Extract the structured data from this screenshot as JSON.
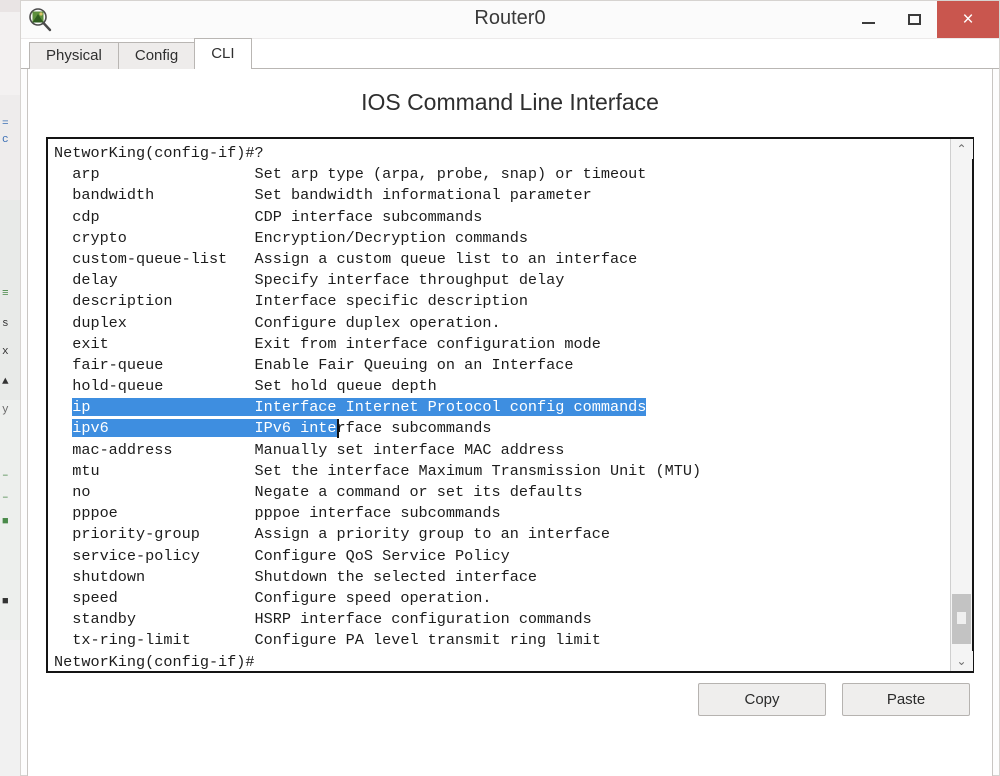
{
  "window": {
    "title": "Router0",
    "app_icon": "packet-tracer-icon",
    "controls": {
      "minimize": "minimize-icon",
      "maximize": "maximize-icon",
      "close": "×",
      "close_color": "#c9564e"
    }
  },
  "tabs": [
    {
      "label": "Physical",
      "active": false
    },
    {
      "label": "Config",
      "active": false
    },
    {
      "label": "CLI",
      "active": true
    }
  ],
  "panel": {
    "heading": "IOS Command Line Interface"
  },
  "terminal": {
    "prompt_top": "NetworKing(config-if)#?",
    "prompt_bottom": "NetworKing(config-if)#",
    "selection_color": "#3e8ee0",
    "rows": [
      {
        "command": "arp",
        "description": "Set arp type (arpa, probe, snap) or timeout",
        "selected": false
      },
      {
        "command": "bandwidth",
        "description": "Set bandwidth informational parameter",
        "selected": false
      },
      {
        "command": "cdp",
        "description": "CDP interface subcommands",
        "selected": false
      },
      {
        "command": "crypto",
        "description": "Encryption/Decryption commands",
        "selected": false
      },
      {
        "command": "custom-queue-list",
        "description": "Assign a custom queue list to an interface",
        "selected": false
      },
      {
        "command": "delay",
        "description": "Specify interface throughput delay",
        "selected": false
      },
      {
        "command": "description",
        "description": "Interface specific description",
        "selected": false
      },
      {
        "command": "duplex",
        "description": "Configure duplex operation.",
        "selected": false
      },
      {
        "command": "exit",
        "description": "Exit from interface configuration mode",
        "selected": false
      },
      {
        "command": "fair-queue",
        "description": "Enable Fair Queuing on an Interface",
        "selected": false
      },
      {
        "command": "hold-queue",
        "description": "Set hold queue depth",
        "selected": false
      },
      {
        "command": "ip",
        "description": "Interface Internet Protocol config commands",
        "selected": true
      },
      {
        "command": "ipv6",
        "description": "IPv6 interface subcommands",
        "selected": true,
        "selection_end_col": 9
      },
      {
        "command": "mac-address",
        "description": "Manually set interface MAC address",
        "selected": false
      },
      {
        "command": "mtu",
        "description": "Set the interface Maximum Transmission Unit (MTU)",
        "selected": false
      },
      {
        "command": "no",
        "description": "Negate a command or set its defaults",
        "selected": false
      },
      {
        "command": "pppoe",
        "description": "pppoe interface subcommands",
        "selected": false
      },
      {
        "command": "priority-group",
        "description": "Assign a priority group to an interface",
        "selected": false
      },
      {
        "command": "service-policy",
        "description": "Configure QoS Service Policy",
        "selected": false
      },
      {
        "command": "shutdown",
        "description": "Shutdown the selected interface",
        "selected": false
      },
      {
        "command": "speed",
        "description": "Configure speed operation.",
        "selected": false
      },
      {
        "command": "standby",
        "description": "HSRP interface configuration commands",
        "selected": false
      },
      {
        "command": "tx-ring-limit",
        "description": "Configure PA level transmit ring limit",
        "selected": false
      }
    ]
  },
  "scrollbar": {
    "up_arrow": "⌃",
    "down_arrow": "⌄"
  },
  "buttons": {
    "copy": "Copy",
    "paste": "Paste"
  },
  "background_sliver": {
    "fragments": [
      "=",
      "c",
      "≡",
      "s",
      "x",
      "▲",
      "y",
      "–",
      "–",
      "■",
      "■"
    ]
  }
}
